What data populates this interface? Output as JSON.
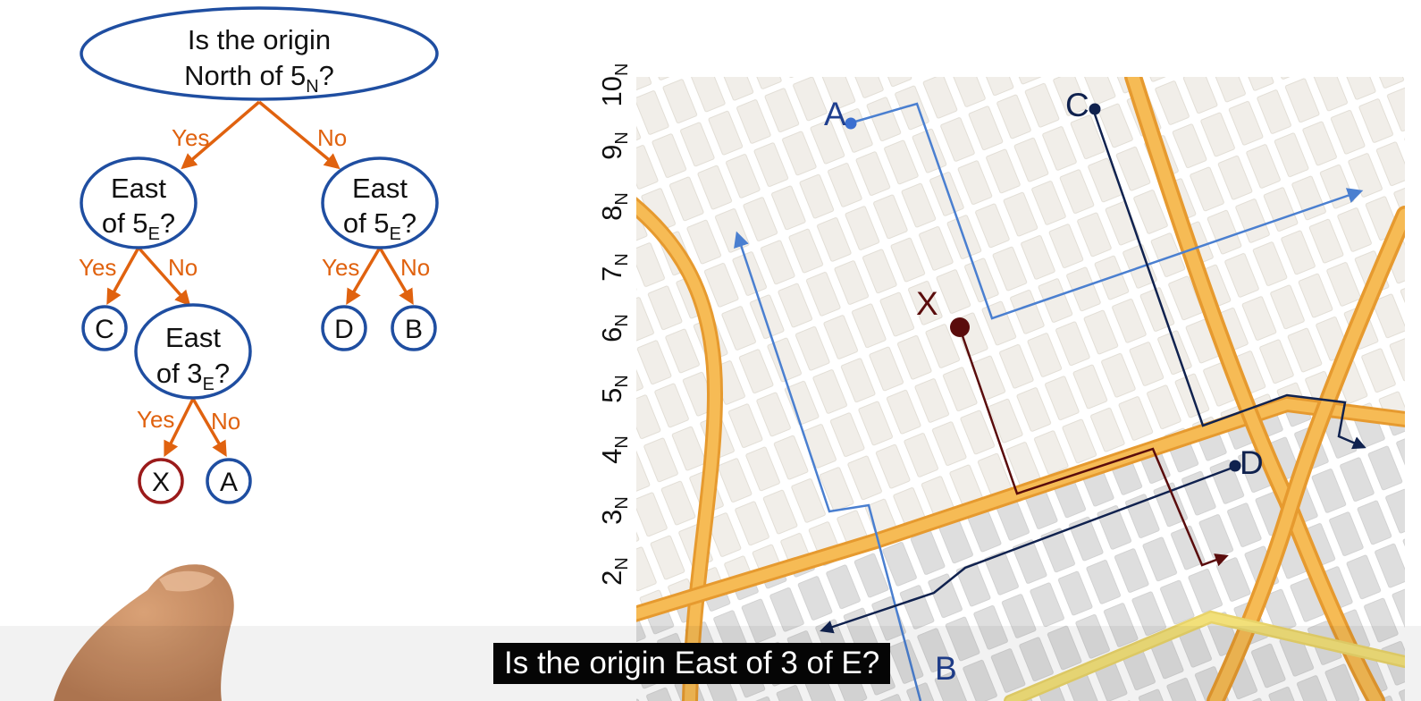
{
  "tree": {
    "root": {
      "line1": "Is the origin",
      "line2": "North of 5",
      "sub": "N",
      "tail": "?"
    },
    "left": {
      "line1": "East",
      "line2": "of 5",
      "sub": "E",
      "tail": "?"
    },
    "right": {
      "line1": "East",
      "line2": "of 5",
      "sub": "E",
      "tail": "?"
    },
    "inner": {
      "line1": "East",
      "line2": "of 3",
      "sub": "E",
      "tail": "?"
    },
    "edges": {
      "root_yes": "Yes",
      "root_no": "No",
      "left_yes": "Yes",
      "left_no": "No",
      "right_yes": "Yes",
      "right_no": "No",
      "inner_yes": "Yes",
      "inner_no": "No"
    },
    "leaves": {
      "c": "C",
      "d": "D",
      "b": "B",
      "x": "X",
      "a": "A"
    }
  },
  "map": {
    "axis_labels": [
      {
        "num": "10",
        "sub": "N"
      },
      {
        "num": "9",
        "sub": "N"
      },
      {
        "num": "8",
        "sub": "N"
      },
      {
        "num": "7",
        "sub": "N"
      },
      {
        "num": "6",
        "sub": "N"
      },
      {
        "num": "5",
        "sub": "N"
      },
      {
        "num": "4",
        "sub": "N"
      },
      {
        "num": "3",
        "sub": "N"
      },
      {
        "num": "2",
        "sub": "N"
      }
    ],
    "points": {
      "a": "A",
      "c": "C",
      "x": "X",
      "d": "D",
      "b": "B"
    }
  },
  "colors": {
    "tree_outline": "#1f4ea1",
    "edge_orange": "#e0620f",
    "leaf_x": "#9b1b1b",
    "route_a": "#4a7fd0",
    "route_c": "#10224f",
    "route_x": "#5a0c0c",
    "arterial": "#f3ae44",
    "highway_yellow": "#f2e07a"
  },
  "caption": "Is the origin East of 3 of E?"
}
